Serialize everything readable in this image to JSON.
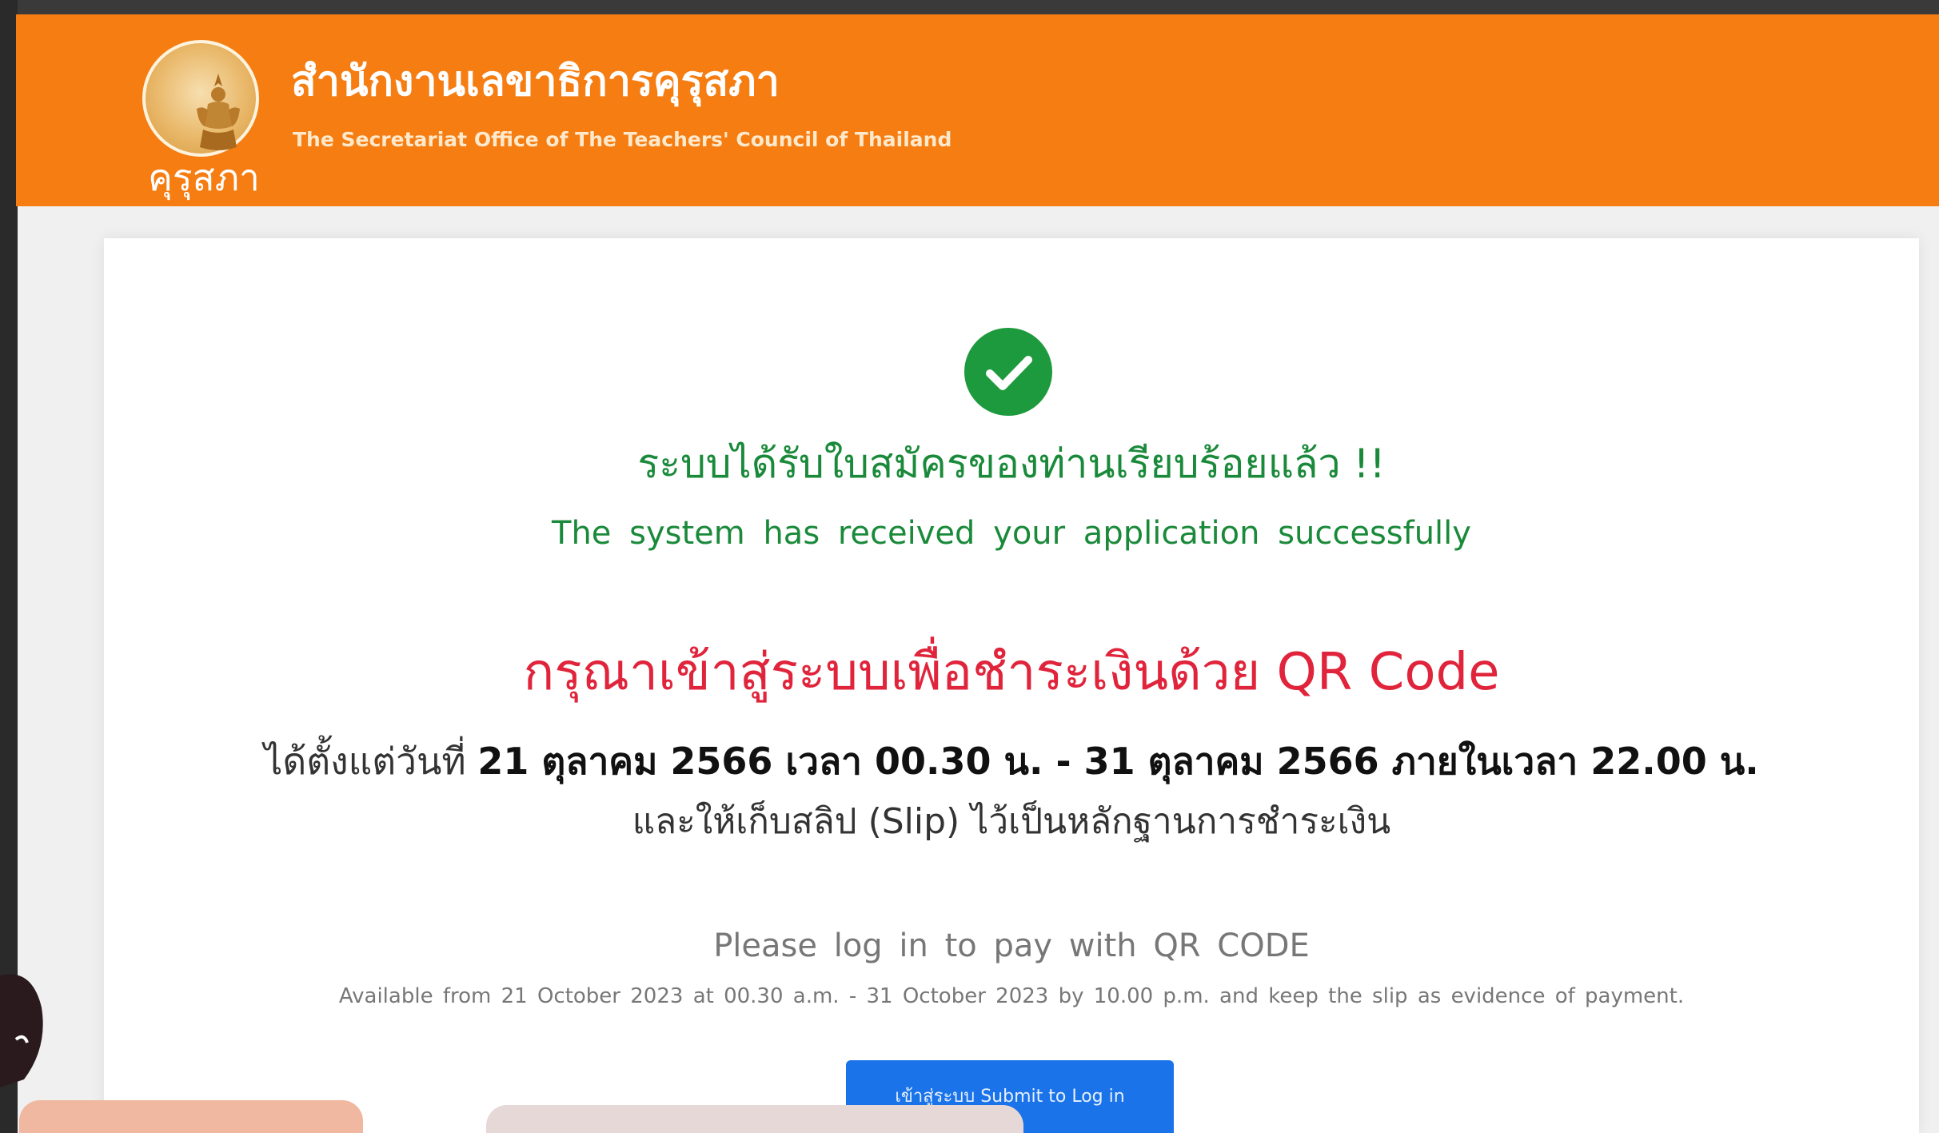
{
  "header": {
    "logo_text": "คุรุสภา",
    "org_name_th": "สำนักงานเลขาธิการคุรุสภา",
    "org_name_en": "The Secretariat Office of The Teachers' Council of Thailand"
  },
  "status": {
    "icon": "check-circle-icon",
    "success_th": "ระบบได้รับใบสมัครของท่านเรียบร้อยแล้ว !!",
    "success_en": "The system has received your application successfully"
  },
  "instructions": {
    "login_th": "กรุณาเข้าสู่ระบบเพื่อชำระเงินด้วย QR Code",
    "period_lead_th": "ได้ตั้งแต่วันที่",
    "period_th": "21 ตุลาคม 2566 เวลา 00.30 น. - 31 ตุลาคม 2566 ภายในเวลา 22.00 น.",
    "slip_th": "และให้เก็บสลิป (Slip) ไว้เป็นหลักฐานการชำระเงิน",
    "login_en": "Please log in to pay with QR CODE",
    "available_en": "Available from 21 October 2023 at 00.30 a.m. - 31 October 2023 by 10.00 p.m. and keep the slip as evidence of payment."
  },
  "actions": {
    "submit_label": "เข้าสู่ระบบ Submit to Log in"
  },
  "colors": {
    "header": "#f57d12",
    "success": "#1a8a3a",
    "alert": "#e0243b",
    "button": "#1a73e8"
  }
}
